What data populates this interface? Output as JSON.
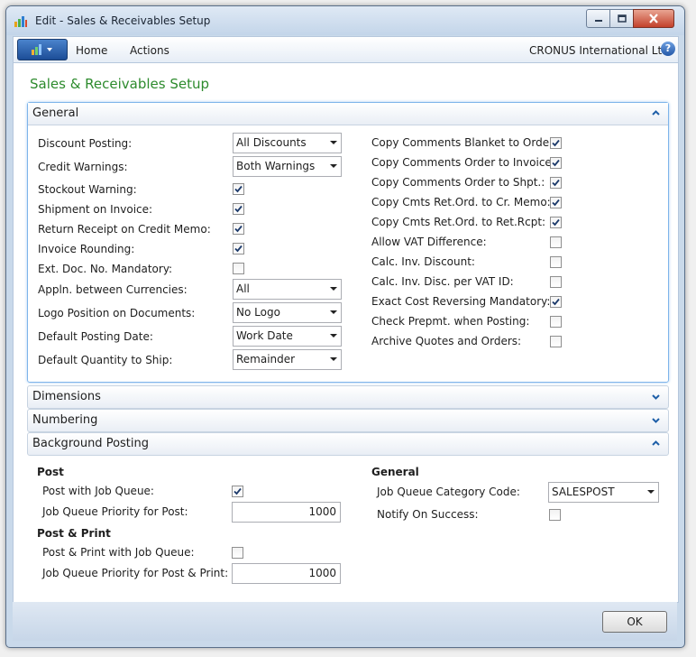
{
  "window": {
    "title": "Edit - Sales & Receivables Setup"
  },
  "ribbon": {
    "menu_home": "Home",
    "menu_actions": "Actions",
    "company": "CRONUS International Ltd.",
    "help": "?"
  },
  "page": {
    "title": "Sales & Receivables Setup"
  },
  "general": {
    "tab_label": "General",
    "discount_posting": {
      "label": "Discount Posting:",
      "value": "All Discounts"
    },
    "credit_warnings": {
      "label": "Credit Warnings:",
      "value": "Both Warnings"
    },
    "stockout_warning": {
      "label": "Stockout Warning:",
      "checked": true
    },
    "shipment_on_invoice": {
      "label": "Shipment on Invoice:",
      "checked": true
    },
    "return_receipt": {
      "label": "Return Receipt on Credit Memo:",
      "checked": true
    },
    "invoice_rounding": {
      "label": "Invoice Rounding:",
      "checked": true
    },
    "ext_doc_mandatory": {
      "label": "Ext. Doc. No. Mandatory:",
      "checked": false
    },
    "appln_currencies": {
      "label": "Appln. between Currencies:",
      "value": "All"
    },
    "logo_position": {
      "label": "Logo Position on Documents:",
      "value": "No Logo"
    },
    "default_posting_date": {
      "label": "Default Posting Date:",
      "value": "Work Date"
    },
    "default_qty_ship": {
      "label": "Default Quantity to Ship:",
      "value": "Remainder"
    },
    "copy_comments_blanket": {
      "label": "Copy Comments Blanket to Order:",
      "checked": true
    },
    "copy_comments_invoice": {
      "label": "Copy Comments Order to Invoice:",
      "checked": true
    },
    "copy_comments_shpt": {
      "label": "Copy Comments Order to Shpt.:",
      "checked": true
    },
    "copy_cmts_cr_memo": {
      "label": "Copy Cmts Ret.Ord. to Cr. Memo:",
      "checked": true
    },
    "copy_cmts_ret_rcpt": {
      "label": "Copy Cmts Ret.Ord. to Ret.Rcpt:",
      "checked": true
    },
    "allow_vat_diff": {
      "label": "Allow VAT Difference:",
      "checked": false
    },
    "calc_inv_discount": {
      "label": "Calc. Inv. Discount:",
      "checked": false
    },
    "calc_inv_disc_vat": {
      "label": "Calc. Inv. Disc. per VAT ID:",
      "checked": false
    },
    "exact_cost_reversing": {
      "label": "Exact Cost Reversing Mandatory:",
      "checked": true
    },
    "check_prepmt": {
      "label": "Check Prepmt. when Posting:",
      "checked": false
    },
    "archive_quotes": {
      "label": "Archive Quotes and Orders:",
      "checked": false
    }
  },
  "dimensions": {
    "tab_label": "Dimensions"
  },
  "numbering": {
    "tab_label": "Numbering"
  },
  "background_posting": {
    "tab_label": "Background Posting",
    "post_heading": "Post",
    "post_with_jq": {
      "label": "Post with Job Queue:",
      "checked": true
    },
    "jq_priority_post": {
      "label": "Job Queue Priority for Post:",
      "value": "1000"
    },
    "post_print_heading": "Post & Print",
    "post_print_with_jq": {
      "label": "Post & Print with Job Queue:",
      "checked": false
    },
    "jq_priority_post_print": {
      "label": "Job Queue Priority for Post & Print:",
      "value": "1000"
    },
    "general_heading": "General",
    "jq_category_code": {
      "label": "Job Queue Category Code:",
      "value": "SALESPOST"
    },
    "notify_on_success": {
      "label": "Notify On Success:",
      "checked": false
    }
  },
  "footer": {
    "ok_label": "OK"
  }
}
